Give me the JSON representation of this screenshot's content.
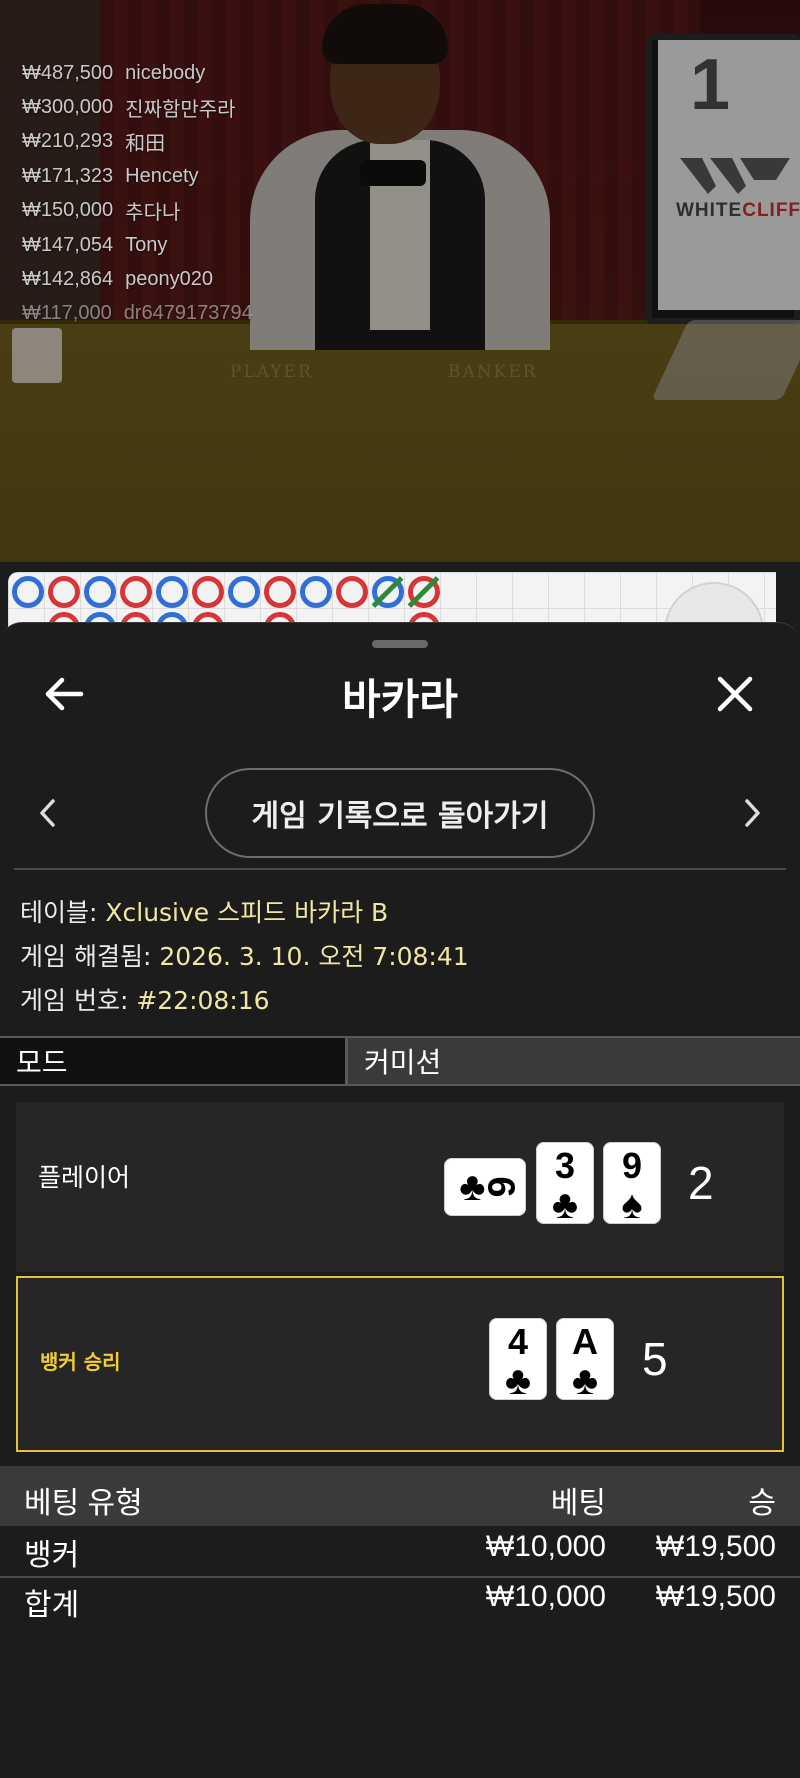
{
  "video": {
    "round_number": "1",
    "brand": {
      "left": "WHITE",
      "right": "CLIFF"
    },
    "felt_left": "PLAYER",
    "felt_right": "BANKER"
  },
  "winners": [
    {
      "amount": "₩487,500",
      "name": "nicebody"
    },
    {
      "amount": "₩300,000",
      "name": "진짜함만주라"
    },
    {
      "amount": "₩210,293",
      "name": "和田"
    },
    {
      "amount": "₩171,323",
      "name": "Hencety"
    },
    {
      "amount": "₩150,000",
      "name": "추다나"
    },
    {
      "amount": "₩147,054",
      "name": "Tony"
    },
    {
      "amount": "₩142,864",
      "name": "peony020"
    },
    {
      "amount": "₩117,000",
      "name": "dr6479173794"
    }
  ],
  "header": {
    "title": "바카라",
    "back_icon": "arrow-left-icon",
    "close_icon": "close-icon"
  },
  "navigation": {
    "history_button": "게임 기록으로 돌아가기",
    "prev_icon": "chevron-left-icon",
    "next_icon": "chevron-right-icon"
  },
  "game_info": {
    "table_label": "테이블: ",
    "table_value": "Xclusive 스피드 바카라 B",
    "resolved_label": "게임 해결됨: ",
    "resolved_value": "2026. 3. 10. 오전 7:08:41",
    "number_label": "게임 번호: ",
    "number_value": "#22:08:16"
  },
  "tabs": {
    "mode": "모드",
    "commission": "커미션"
  },
  "player_hand": {
    "label": "플레이어",
    "score": "2",
    "cards": [
      {
        "rank": "6",
        "suit": "♣"
      },
      {
        "rank": "3",
        "suit": "♣"
      },
      {
        "rank": "9",
        "suit": "♠"
      }
    ]
  },
  "banker_hand": {
    "label": "뱅커 승리",
    "score": "5",
    "cards": [
      {
        "rank": "4",
        "suit": "♣"
      },
      {
        "rank": "A",
        "suit": "♣"
      }
    ]
  },
  "bets": {
    "headers": {
      "type": "베팅 유형",
      "bet": "베팅",
      "win": "승"
    },
    "rows": [
      {
        "type": "뱅커",
        "bet": "₩10,000",
        "win": "₩19,500"
      }
    ],
    "total": {
      "type": "합계",
      "bet": "₩10,000",
      "win": "₩19,500"
    }
  },
  "colors": {
    "accent_yellow": "#e2c33b",
    "value_text": "#f1e6a4",
    "player_blue": "#2f6fd6",
    "banker_red": "#d63636",
    "tie_green": "#2a8a3a"
  }
}
